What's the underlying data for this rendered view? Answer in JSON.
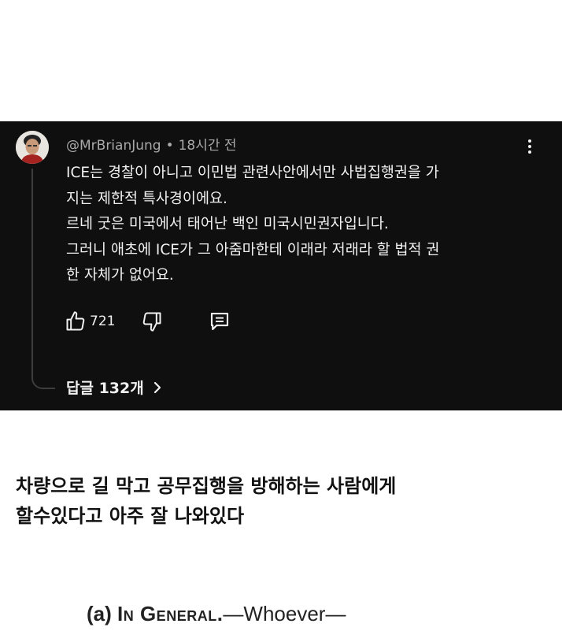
{
  "comment": {
    "author": "@MrBrianJung",
    "separator": "•",
    "time": "18시간 전",
    "lines": [
      "ICE는 경찰이 아니고 이민법 관련사안에서만 사법집행권을 가",
      "지는 제한적 특사경이에요.",
      "르네 굿은 미국에서 태어난 백인 미국시민권자입니다.",
      "그러니 애초에 ICE가 그 아줌마한테 이래라 저래라 할 법적 권",
      "한 자체가 없어요."
    ],
    "like_count": "721",
    "replies_label": "답글 132개",
    "icons": {
      "avatar": "user-avatar",
      "more": "more-vert-icon",
      "like": "thumbs-up-icon",
      "dislike": "thumbs-down-icon",
      "reply": "comment-icon",
      "replies_arrow": "chevron-right-icon"
    }
  },
  "caption": {
    "lines": [
      "차량으로 길 막고 공무집행을 방해하는 사람에게",
      "할수있다고 아주 잘 나와있다"
    ]
  },
  "statute": {
    "label": "(a)",
    "heading": "In General.",
    "rest": "—Whoever—"
  },
  "colors": {
    "card_bg": "#0f0f0f",
    "text_primary": "#f1f1f1",
    "text_secondary": "#aaaaaa",
    "page_bg": "#ffffff"
  }
}
